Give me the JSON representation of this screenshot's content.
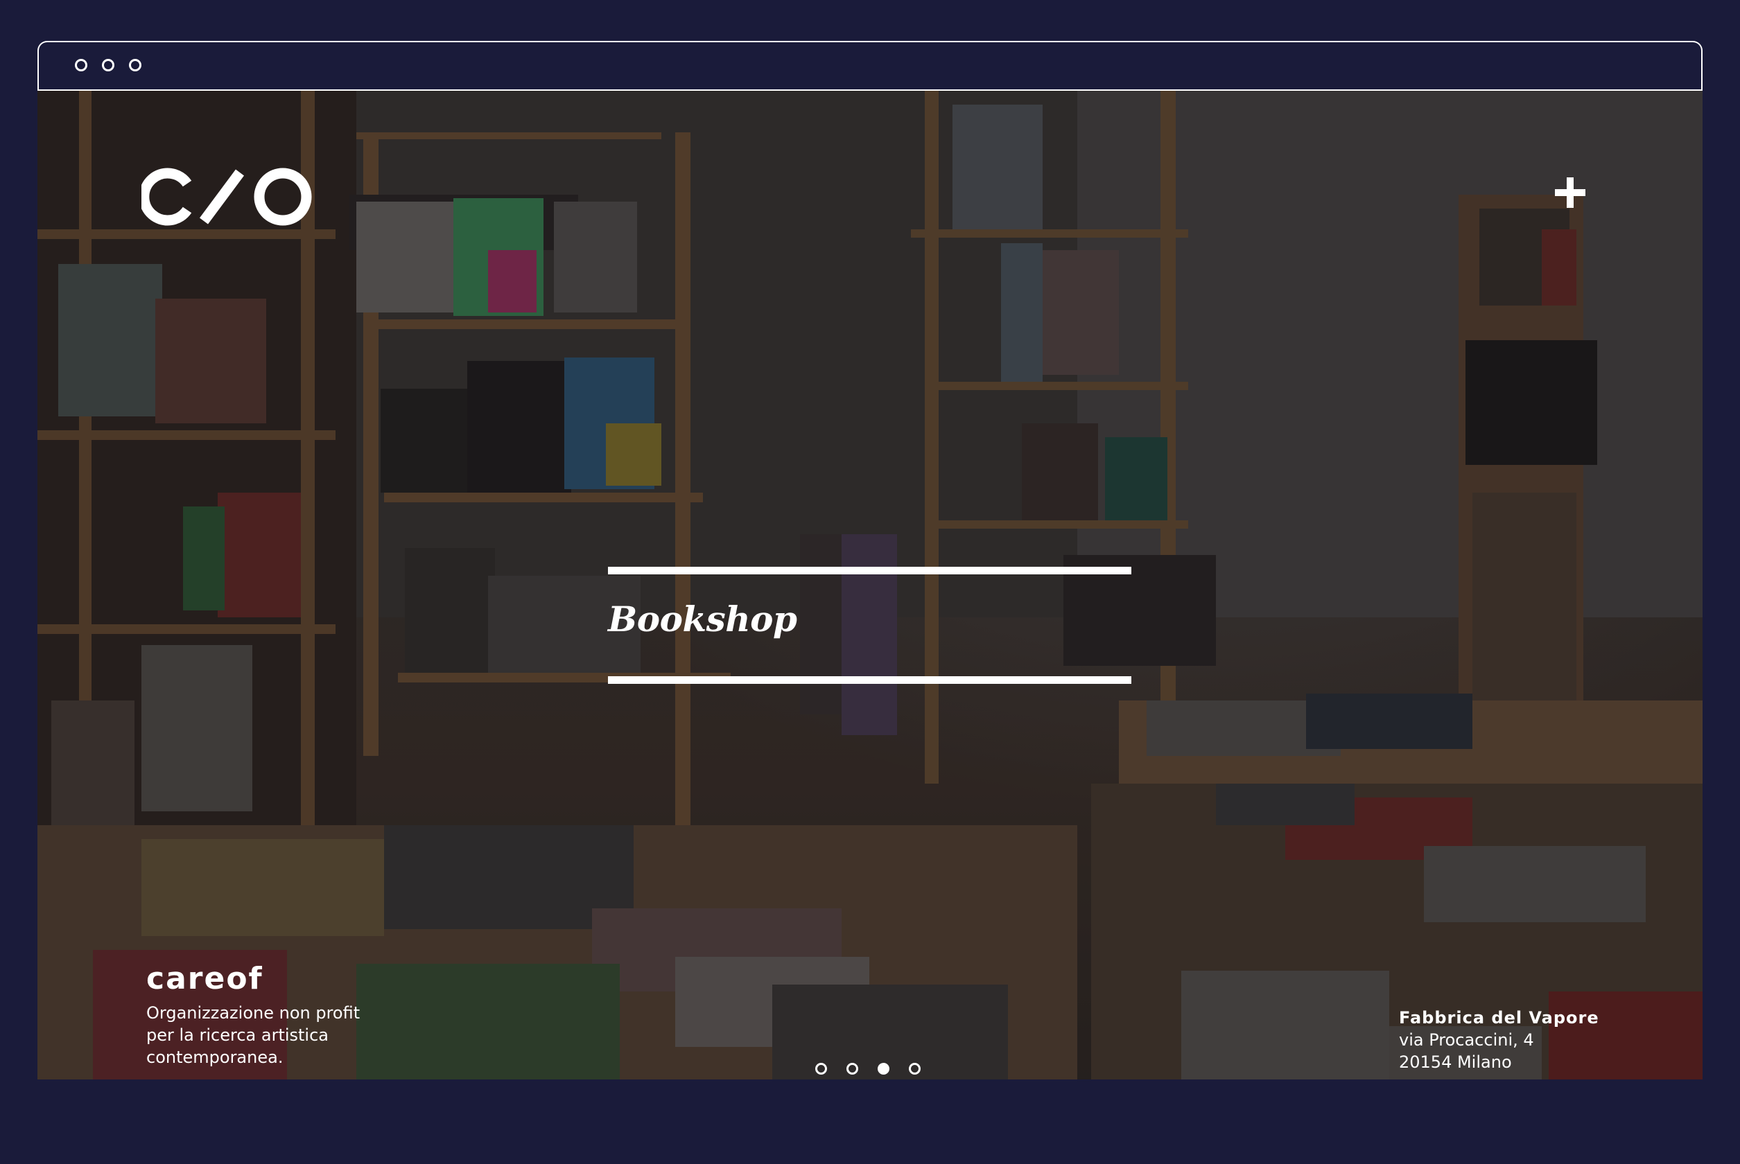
{
  "window": {
    "controls": [
      "window-dot-1",
      "window-dot-2",
      "window-dot-3"
    ]
  },
  "header": {
    "logo_text": "C/O",
    "menu_icon": "plus-icon"
  },
  "hero": {
    "title": "Bookshop"
  },
  "brand": {
    "name": "careof",
    "description_lines": [
      "Organizzazione non profit",
      "per la ricerca artistica",
      "contemporanea."
    ]
  },
  "address": {
    "name": "Fabbrica del Vapore",
    "street": "via Procaccini, 4",
    "city": "20154 Milano"
  },
  "pager": {
    "count": 4,
    "active_index": 2
  },
  "colors": {
    "page_background": "#1a1b3a",
    "foreground": "#ffffff"
  }
}
